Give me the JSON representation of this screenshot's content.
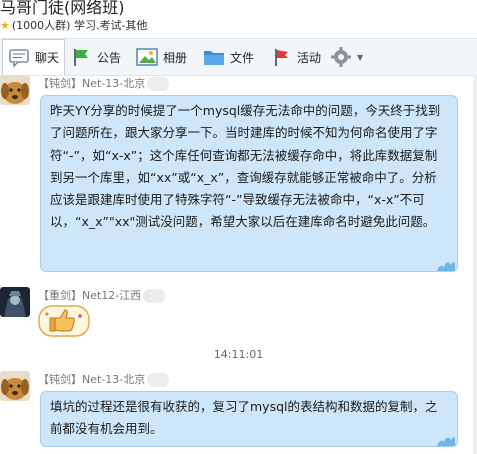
{
  "group": {
    "title": "马哥门徒(网络班)",
    "subtitle": "(1000人群) 学习.考试-其他"
  },
  "toolbar": {
    "chat": "聊天",
    "notice": "公告",
    "album": "相册",
    "files": "文件",
    "activity": "活动"
  },
  "messages": [
    {
      "sender": "【钝剑】Net-13-北京",
      "text": "昨天YY分享的时候提了一个mysql缓存无法命中的问题，今天终于找到了问题所在，跟大家分享一下。当时建库的时候不知为何命名使用了字符“-”，如“x-x”；这个库任何查询都无法被缓存命中，将此库数据复制到另一个库里，如“xx”或“x_x”，查询缓存就能够正常被命中了。分析应该是跟建库时使用了特殊字符“-”导致缓存无法被命中，“x-x”不可以，“x_x”\"xx\"测试没问题，希望大家以后在建库命名时避免此问题。"
    },
    {
      "sender": "【重剑】Net12-江西"
    },
    {
      "sender": "【钝剑】Net-13-北京",
      "text": "填坑的过程还是很有收获的，复习了mysql的表结构和数据的复制，之前都没有机会用到。"
    }
  ],
  "timestamp": "14:11:01"
}
